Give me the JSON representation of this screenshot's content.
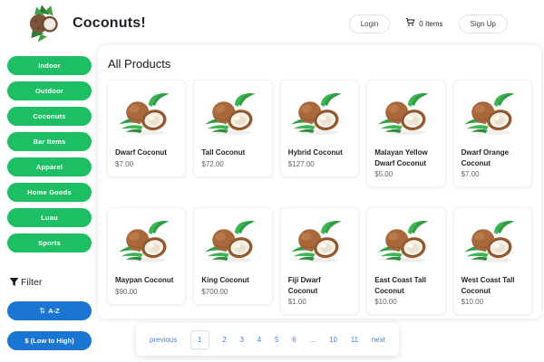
{
  "colors": {
    "category_green": "#1ebe64",
    "sort_blue": "#1a76d2",
    "link_blue": "#4a7dd6"
  },
  "header": {
    "title": "Coconuts!",
    "login_label": "Login",
    "cart_count": "0 Items",
    "signup_label": "Sign Up",
    "logo_icon": "coconut-logo",
    "cart_icon": "shopping-cart"
  },
  "sidebar": {
    "categories": [
      "Indoor",
      "Outdoor",
      "Coconuts",
      "Bar Items",
      "Apparel",
      "Home Goods",
      "Luau",
      "Sports"
    ],
    "filter_label": "Filter",
    "filter_icon": "funnel",
    "sort_az_icon": "sort-arrows",
    "sort_az_glyph": "⇅",
    "sort_az_label": "A-Z",
    "sort_price_label": "$   (Low to High)"
  },
  "main": {
    "heading": "All Products",
    "products": [
      {
        "name": "Dwarf Coconut",
        "price": "$7.00"
      },
      {
        "name": "Tall Coconut",
        "price": "$72.00"
      },
      {
        "name": "Hybrid Coconut",
        "price": "$127.00"
      },
      {
        "name": "Malayan Yellow Dwarf Coconut",
        "price": "$5.00"
      },
      {
        "name": "Dwarf Orange Coconut",
        "price": "$7.00"
      },
      {
        "name": "Maypan Coconut",
        "price": "$90.00"
      },
      {
        "name": "King Coconut",
        "price": "$700.00"
      },
      {
        "name": "Fiji Dwarf Coconut",
        "price": "$1.00"
      },
      {
        "name": "East Coast Tall Coconut",
        "price": "$10.00"
      },
      {
        "name": "West Coast Tall Coconut",
        "price": "$10.00"
      }
    ]
  },
  "pagination": {
    "current_page": "1",
    "items": [
      "previous",
      "1",
      "2",
      "3",
      "4",
      "5",
      "6",
      "...",
      "10",
      "11",
      "next"
    ]
  }
}
